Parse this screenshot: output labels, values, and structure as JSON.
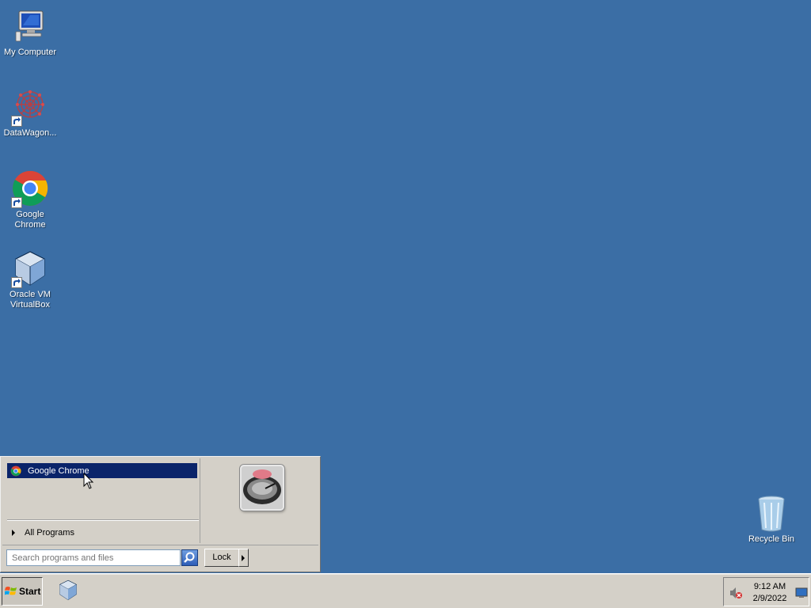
{
  "desktop": {
    "icons": [
      {
        "label": "My Computer",
        "icon": "computer-icon"
      },
      {
        "label": "DataWagon...",
        "icon": "datawagon-icon"
      },
      {
        "label": "Google Chrome",
        "icon": "chrome-icon"
      },
      {
        "label": "Oracle VM VirtualBox",
        "icon": "virtualbox-icon"
      },
      {
        "label": "Recycle Bin",
        "icon": "recycle-bin-icon"
      }
    ],
    "background_color": "#3b6ea5"
  },
  "start_menu": {
    "pinned": [
      {
        "label": "Google Chrome",
        "icon": "chrome-icon"
      }
    ],
    "all_programs_label": "All Programs",
    "search_placeholder": "Search programs and files",
    "lock_label": "Lock"
  },
  "taskbar": {
    "start_label": "Start",
    "clock_time": "9:12 AM",
    "clock_date": "2/9/2022"
  }
}
